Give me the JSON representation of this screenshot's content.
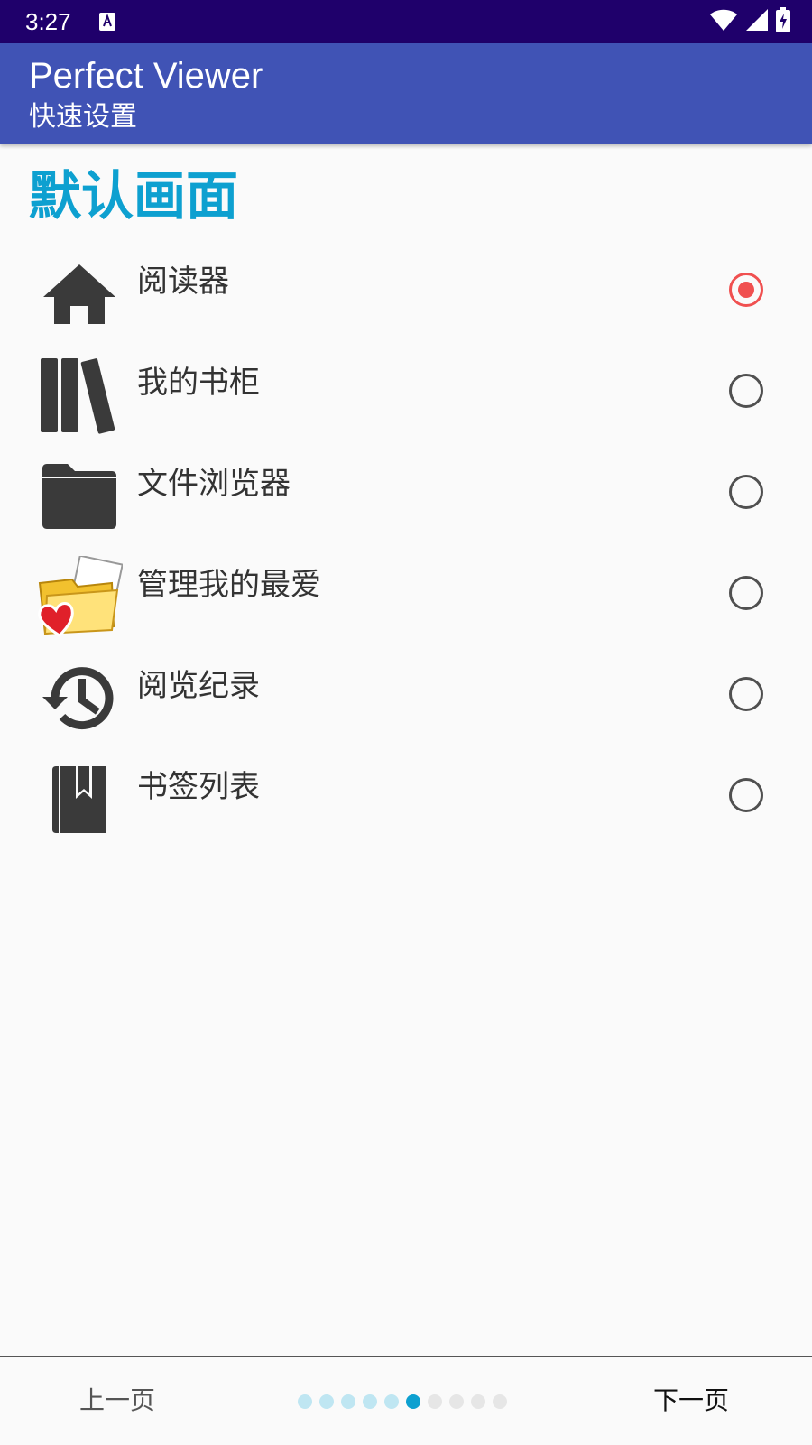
{
  "status_bar": {
    "time": "3:27",
    "icons": [
      "text-a-icon",
      "wifi-icon",
      "cell-signal-icon",
      "battery-charging-icon"
    ]
  },
  "app_bar": {
    "title": "Perfect Viewer",
    "subtitle": "快速设置"
  },
  "section": {
    "title": "默认画面"
  },
  "options": [
    {
      "label": "阅读器",
      "icon": "home-icon",
      "checked": true
    },
    {
      "label": "我的书柜",
      "icon": "bookshelf-icon",
      "checked": false
    },
    {
      "label": "文件浏览器",
      "icon": "folder-icon",
      "checked": false
    },
    {
      "label": "管理我的最爱",
      "icon": "favorite-folder-icon",
      "checked": false
    },
    {
      "label": "阅览纪录",
      "icon": "history-icon",
      "checked": false
    },
    {
      "label": "书签列表",
      "icon": "bookmark-book-icon",
      "checked": false
    }
  ],
  "navigation": {
    "prev_label": "上一页",
    "next_label": "下一页",
    "page_total": 10,
    "page_current": 6
  },
  "colors": {
    "status_bar": "#1f006b",
    "app_bar": "#4053b5",
    "section_title": "#0da0d0",
    "radio_checked": "#f05050",
    "icon": "#3a3a3a"
  }
}
